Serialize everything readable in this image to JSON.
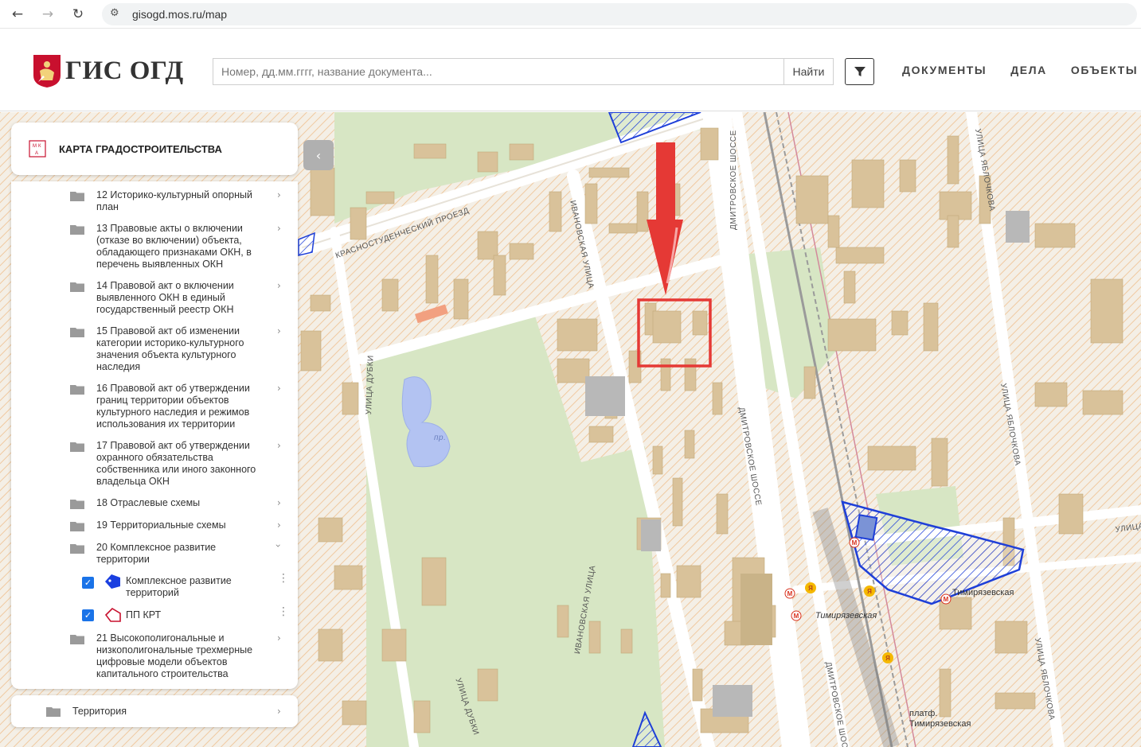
{
  "browser": {
    "url": "gisogd.mos.ru/map",
    "back_icon": "back-arrow-icon",
    "forward_icon": "forward-arrow-icon",
    "reload_icon": "reload-icon"
  },
  "header": {
    "logo_text": "ГИС ОГД",
    "search_placeholder": "Номер, дд.мм.гггг, название документа...",
    "search_button": "Найти",
    "nav": [
      "ДОКУМЕНТЫ",
      "ДЕЛА",
      "ОБЪЕКТЫ"
    ]
  },
  "panel": {
    "title": "КАРТА ГРАДОСТРОИТЕЛЬСТВА",
    "layers": [
      {
        "label": "12 Историко-культурный опорный план"
      },
      {
        "label": "13 Правовые акты о включении (отказе во включении) объекта, обладающего признаками ОКН, в перечень выявленных ОКН"
      },
      {
        "label": "14 Правовой акт о включении выявленного ОКН в единый государственный реестр ОКН"
      },
      {
        "label": "15 Правовой акт об изменении категории историко-культурного значения объекта культурного наследия"
      },
      {
        "label": "16 Правовой акт об утверждении границ территории объектов культурного наследия и режимов использования их территории"
      },
      {
        "label": "17 Правовой акт об утверждении охранного обязательства собственника или иного законного владельца ОКН"
      },
      {
        "label": "18 Отраслевые схемы"
      },
      {
        "label": "19 Территориальные схемы"
      },
      {
        "label": "20 Комплексное развитие территории"
      }
    ],
    "sublayers": [
      {
        "label": "Комплексное развитие территорий",
        "checked": true
      },
      {
        "label": "ПП КРТ",
        "checked": true
      }
    ],
    "last_layer": "21 Высокополигональные и низкополигональные трехмерные цифровые модели объектов капитального строительства",
    "bottom_item": "Территория"
  },
  "map": {
    "streets": {
      "krasnostud": "КРАСНОСТУДЕНЧЕСКИЙ ПРОЕЗД",
      "dmitrovskoe1": "ДМИТРОВСКОЕ ШОССЕ",
      "dmitrovskoe2": "ДМИТРОВСКОЕ ШОССЕ",
      "dmitrovskoe3": "ДМИТРОВСКОЕ ШОС",
      "ivanovskaya1": "ИВАНОВСКАЯ УЛИЦА",
      "ivanovskaya2": "ИВАНОВСКАЯ УЛИЦА",
      "dubki1": "УЛИЦА ДУБКИ",
      "dubki2": "УЛИЦА ДУБКИ",
      "yablochkova1": "УЛИЦА ЯБЛОЧКОВА",
      "yablochkova2": "УЛИЦА ЯБЛОЧКОВА",
      "yablochkova3": "УЛИЦА ЯБЛОЧКОВА",
      "ulitsa": "УЛИЦА"
    },
    "pond_label": "пр.",
    "stations": {
      "timiryazevskaya1": "Тимирязевская",
      "timiryazevskaya2": "Тимирязевская",
      "platform": "платф.",
      "platform2": "Тимирязевская"
    },
    "colors": {
      "highlight": "#e53935",
      "krt": "#1e3fd8",
      "building": "#d9c29a",
      "park": "#d7e6c4"
    }
  }
}
